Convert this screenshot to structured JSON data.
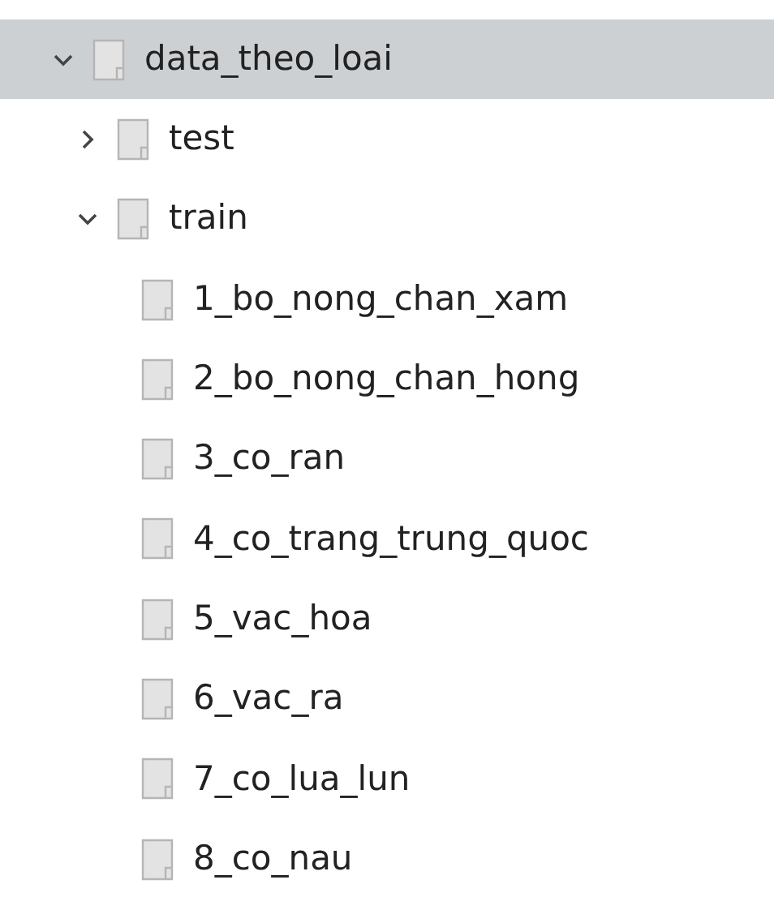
{
  "tree": [
    {
      "label": "data_theo_loai",
      "selected": true,
      "expanded": true,
      "children": [
        {
          "label": "test",
          "selected": false,
          "expanded": false
        },
        {
          "label": "train",
          "selected": false,
          "expanded": true,
          "children": [
            {
              "label": "1_bo_nong_chan_xam",
              "selected": false
            },
            {
              "label": "2_bo_nong_chan_hong",
              "selected": false
            },
            {
              "label": "3_co_ran",
              "selected": false
            },
            {
              "label": "4_co_trang_trung_quoc",
              "selected": false
            },
            {
              "label": "5_vac_hoa",
              "selected": false
            },
            {
              "label": "6_vac_ra",
              "selected": false
            },
            {
              "label": "7_co_lua_lun",
              "selected": false
            },
            {
              "label": "8_co_nau",
              "selected": false
            }
          ]
        }
      ]
    }
  ]
}
